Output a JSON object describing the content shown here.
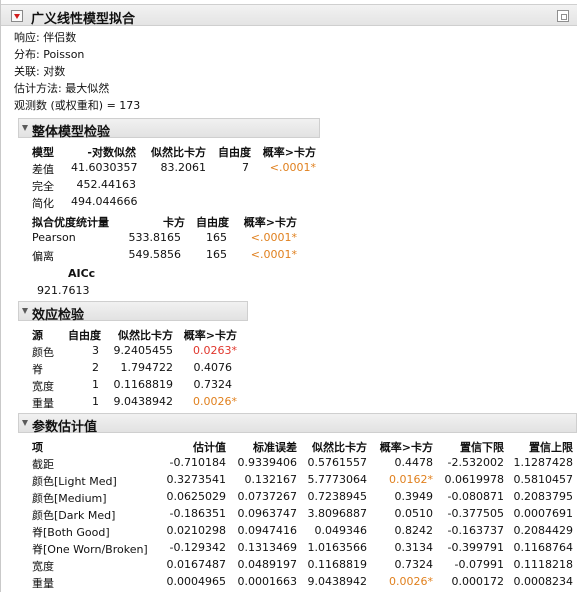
{
  "report_title": "广义线性模型拟合",
  "info": [
    "响应: 伴侣数",
    "分布: Poisson",
    "关联: 对数",
    "估计方法: 最大似然",
    "观测数 (或权重和) = 173"
  ],
  "whole_model": {
    "title": "整体模型检验",
    "headers": [
      "模型",
      "-对数似然",
      "似然比卡方",
      "自由度",
      "概率>卡方"
    ],
    "rows": [
      [
        "差值",
        "41.6030357",
        "83.2061",
        "7",
        "<.0001*"
      ],
      [
        "完全",
        "452.44163",
        "",
        "",
        ""
      ],
      [
        "简化",
        "494.044666",
        "",
        "",
        ""
      ]
    ],
    "gof_headers": [
      "拟合优度统计量",
      "卡方",
      "自由度",
      "概率>卡方"
    ],
    "gof_rows": [
      [
        "Pearson",
        "533.8165",
        "165",
        "<.0001*"
      ],
      [
        "偏离",
        "549.5856",
        "165",
        "<.0001*"
      ]
    ],
    "aicc_label": "AICc",
    "aicc_value": "921.7613"
  },
  "effect_tests": {
    "title": "效应检验",
    "headers": [
      "源",
      "自由度",
      "似然比卡方",
      "概率>卡方"
    ],
    "rows": [
      [
        "颜色",
        "3",
        "9.2405455",
        "0.0263*"
      ],
      [
        "脊",
        "2",
        "1.794722",
        "0.4076"
      ],
      [
        "宽度",
        "1",
        "0.1168819",
        "0.7324"
      ],
      [
        "重量",
        "1",
        "9.0438942",
        "0.0026*"
      ]
    ]
  },
  "param_estimates": {
    "title": "参数估计值",
    "headers": [
      "项",
      "估计值",
      "标准误差",
      "似然比卡方",
      "概率>卡方",
      "置信下限",
      "置信上限"
    ],
    "rows": [
      [
        "截距",
        "-0.710184",
        "0.9339406",
        "0.5761557",
        "0.4478",
        "-2.532002",
        "1.1287428"
      ],
      [
        "颜色[Light Med]",
        "0.3273541",
        "0.132167",
        "5.7773064",
        "0.0162*",
        "0.0619978",
        "0.5810457"
      ],
      [
        "颜色[Medium]",
        "0.0625029",
        "0.0737267",
        "0.7238945",
        "0.3949",
        "-0.080871",
        "0.2083795"
      ],
      [
        "颜色[Dark Med]",
        "-0.186351",
        "0.0963747",
        "3.8096887",
        "0.0510",
        "-0.377505",
        "0.0007691"
      ],
      [
        "脊[Both Good]",
        "0.0210298",
        "0.0947416",
        "0.049346",
        "0.8242",
        "-0.163737",
        "0.2084429"
      ],
      [
        "脊[One Worn/Broken]",
        "-0.129342",
        "0.1313469",
        "1.0163566",
        "0.3134",
        "-0.399791",
        "0.1168764"
      ],
      [
        "宽度",
        "0.0167487",
        "0.0489197",
        "0.1168819",
        "0.7324",
        "-0.07991",
        "0.1118218"
      ],
      [
        "重量",
        "0.0004965",
        "0.0001663",
        "9.0438942",
        "0.0026*",
        "0.000172",
        "0.0008234"
      ]
    ]
  },
  "colors": {
    "significant_orange": "#e0801e",
    "significant_red": "#e0362c"
  },
  "icons": {
    "menu": "red-triangle-menu-icon",
    "collapse": "disclosure-triangle-icon",
    "corner": "window-corner-icon"
  }
}
